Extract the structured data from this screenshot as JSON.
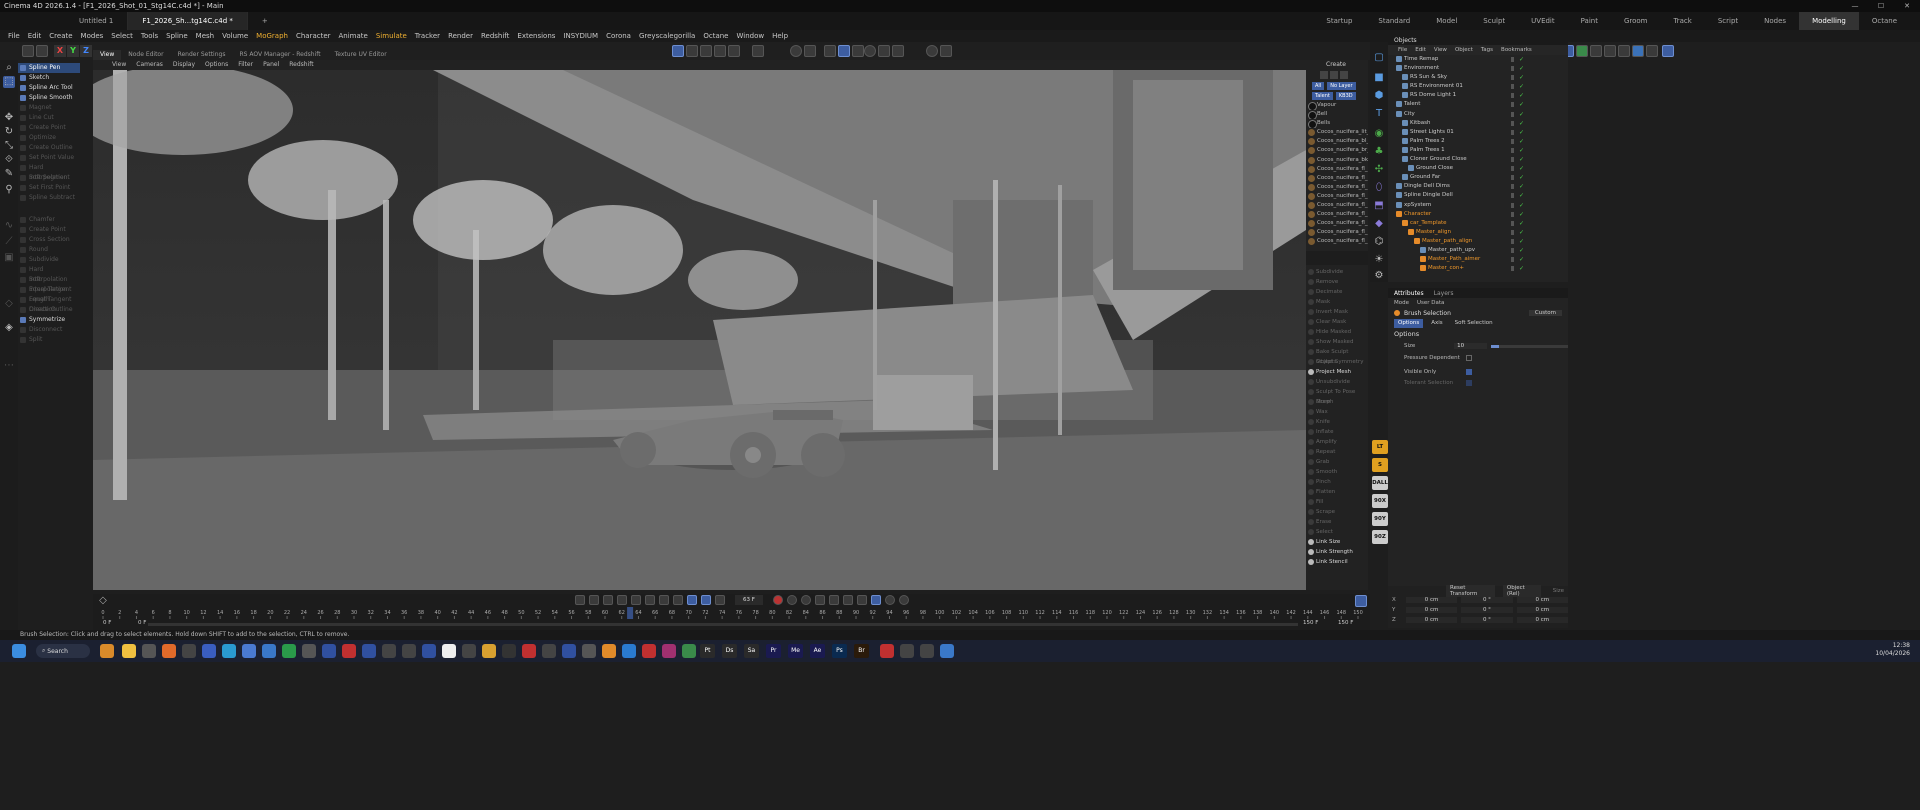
{
  "window": {
    "title": "Cinema 4D 2026.1.4 - [F1_2026_Shot_01_Stg14C.c4d *] - Main",
    "controls": [
      "—",
      "☐",
      "✕"
    ]
  },
  "doc_tabs": [
    "Untitled 1",
    "F1_2026_Sh...tg14C.c4d *"
  ],
  "add_tab": "+",
  "layouts": [
    "Startup",
    "Standard",
    "Model",
    "Sculpt",
    "UVEdit",
    "Paint",
    "Groom",
    "Track",
    "Script",
    "Nodes",
    "Modelling",
    "Octane"
  ],
  "active_layout": "Modelling",
  "menu": [
    "File",
    "Edit",
    "Create",
    "Modes",
    "Select",
    "Tools",
    "Spline",
    "Mesh",
    "Volume",
    "MoGraph",
    "Character",
    "Animate",
    "Simulate",
    "Tracker",
    "Render",
    "Redshift",
    "Extensions",
    "INSYDIUM",
    "Corona",
    "Greyscalegorilla",
    "Octane",
    "Window",
    "Help"
  ],
  "axes": [
    "X",
    "Y",
    "Z"
  ],
  "tool_menu": {
    "active": [
      "Spline Pen",
      "Sketch",
      "Spline Arc Tool",
      "Spline Smooth"
    ],
    "disabled_a": [
      "Magnet",
      "Line Cut",
      "Create Point",
      "Optimize",
      "Create Outline",
      "Set Point Value",
      "Hard Interpolation",
      "Soft Segment",
      "Set First Point",
      "Spline Subtract"
    ],
    "disabled_b": [
      "Chamfer",
      "Create Point",
      "Cross Section",
      "Round",
      "Subdivide",
      "Hard Interpolation",
      "Soft Interpolation",
      "Equal Tangent Length",
      "Equal Tangent Direction",
      "Create Outline"
    ],
    "symmetrize": "Symmetrize",
    "disabled_c": [
      "Disconnect",
      "Split"
    ]
  },
  "viewport_tabs": [
    "View",
    "Node Editor",
    "Render Settings",
    "RS AOV Manager - Redshift",
    "Texture UV Editor"
  ],
  "viewport_menu": [
    "View",
    "Cameras",
    "Display",
    "Options",
    "Filter",
    "Panel",
    "Redshift"
  ],
  "material_panel": {
    "header": "Create",
    "filters": [
      "All",
      "No Layer",
      "Talent",
      "KB3D"
    ],
    "materials": [
      "Vapour",
      "Bell",
      "Bells",
      "Cocos_nucifera_lit_0",
      "Cocos_nucifera_bl_0",
      "Cocos_nucifera_br_0",
      "Cocos_nucifera_bk_0",
      "Cocos_nucifera_fl_1",
      "Cocos_nucifera_fl_1",
      "Cocos_nucifera_fl_1",
      "Cocos_nucifera_fl_01",
      "Cocos_nucifera_fl_0",
      "Cocos_nucifera_fl_0",
      "Cocos_nucifera_fl_0",
      "Cocos_nucifera_fl_0",
      "Cocos_nucifera_fl_0"
    ]
  },
  "sculpt_panel": {
    "items": [
      "Subdivide",
      "Remove",
      "Decimate",
      "Mask",
      "Invert Mask",
      "Clear Mask",
      "Hide Masked",
      "Show Masked",
      "Bake Sculpt Objects",
      "Sculpt Symmetry",
      "Project Mesh",
      "Unsubdivide",
      "Sculpt To Pose Morph",
      "Draw",
      "Wax",
      "Knife",
      "Inflate",
      "Amplify",
      "Repeat",
      "Grab",
      "Smooth",
      "Pinch",
      "Flatten",
      "Fill",
      "Scrape",
      "Erase",
      "Select",
      "Link Size",
      "Link Strength",
      "Link Stencil"
    ],
    "active": [
      "Project Mesh",
      "Link Size",
      "Link Strength",
      "Link Stencil"
    ]
  },
  "objects_panel": {
    "title": "Objects",
    "menu": [
      "File",
      "Edit",
      "View",
      "Object",
      "Tags",
      "Bookmarks"
    ],
    "items": [
      {
        "name": "Time Remap",
        "indent": 1,
        "orange": false
      },
      {
        "name": "Environment",
        "indent": 1,
        "orange": false
      },
      {
        "name": "RS Sun & Sky",
        "indent": 2,
        "orange": false
      },
      {
        "name": "RS Environment 01",
        "indent": 2,
        "orange": false
      },
      {
        "name": "RS Dome Light 1",
        "indent": 2,
        "orange": false
      },
      {
        "name": "Talent",
        "indent": 1,
        "orange": false
      },
      {
        "name": "City",
        "indent": 1,
        "orange": false
      },
      {
        "name": "Kitbash",
        "indent": 2,
        "orange": false
      },
      {
        "name": "Street Lights 01",
        "indent": 2,
        "orange": false
      },
      {
        "name": "Palm Trees 2",
        "indent": 2,
        "orange": false
      },
      {
        "name": "Palm Trees 1",
        "indent": 2,
        "orange": false
      },
      {
        "name": "Cloner Ground Close",
        "indent": 2,
        "orange": false
      },
      {
        "name": "Ground Close",
        "indent": 3,
        "orange": false
      },
      {
        "name": "Ground Far",
        "indent": 2,
        "orange": false
      },
      {
        "name": "Dingle Dell Dims",
        "indent": 1,
        "orange": false
      },
      {
        "name": "Spline Dingle Dell",
        "indent": 1,
        "orange": false
      },
      {
        "name": "xpSystem",
        "indent": 1,
        "orange": false
      },
      {
        "name": "Character",
        "indent": 1,
        "orange": true
      },
      {
        "name": "car_Template",
        "indent": 2,
        "orange": true
      },
      {
        "name": "Master_align",
        "indent": 3,
        "orange": true
      },
      {
        "name": "Master_path_align",
        "indent": 4,
        "orange": true
      },
      {
        "name": "Master_path_upv",
        "indent": 5,
        "orange": false
      },
      {
        "name": "Master_Path_aimer",
        "indent": 5,
        "orange": true
      },
      {
        "name": "Master_con+",
        "indent": 5,
        "orange": true
      }
    ]
  },
  "attributes_panel": {
    "tabs": [
      "Attributes",
      "Layers"
    ],
    "menu": [
      "Mode",
      "User Data"
    ],
    "tool": "Brush Selection",
    "preset": "Custom",
    "subtabs": [
      "Options",
      "Axis",
      "Soft Selection"
    ],
    "section": "Options",
    "size_label": "Size",
    "size_value": "10",
    "size_fraction": 0.1,
    "pressure_label": "Pressure Dependent",
    "visible_only_label": "Visible Only",
    "tolerant_label": "Tolerant Selection"
  },
  "coords_panel": {
    "reset_label": "Reset Transform",
    "mode": "Object (Rel)",
    "apply": "Size",
    "rows": [
      {
        "axis": "X",
        "pos": "0 cm",
        "rot": "0 °",
        "size": "0 cm"
      },
      {
        "axis": "Y",
        "pos": "0 cm",
        "rot": "0 °",
        "size": "0 cm"
      },
      {
        "axis": "Z",
        "pos": "0 cm",
        "rot": "0 °",
        "size": "0 cm"
      }
    ]
  },
  "timeline": {
    "current_frame": "63 F",
    "start_frame": "0 F",
    "min_frame": "0 F",
    "max_frame": "150 F",
    "end_frame": "150 F",
    "ruler_min": 0,
    "ruler_max": 150,
    "ruler_step": 2,
    "playhead": 63
  },
  "status": {
    "text": "Brush Selection: Click and drag to select elements. Hold down SHIFT to add to the selection, CTRL to remove."
  },
  "taskbar": {
    "search": "Search",
    "time": "12:38",
    "date": "10/04/2026",
    "app_labels": [
      "Pt",
      "Ds",
      "Sa",
      "Pr",
      "Me",
      "Ae",
      "Ps",
      "Br"
    ]
  },
  "right_labels": [
    "LT",
    "S",
    "DALL",
    "90X",
    "90Y",
    "90Z"
  ],
  "colors": {
    "accent_blue": "#3d5da0",
    "highlight_orange": "#f0982a",
    "check_green": "#4ccc4c"
  }
}
